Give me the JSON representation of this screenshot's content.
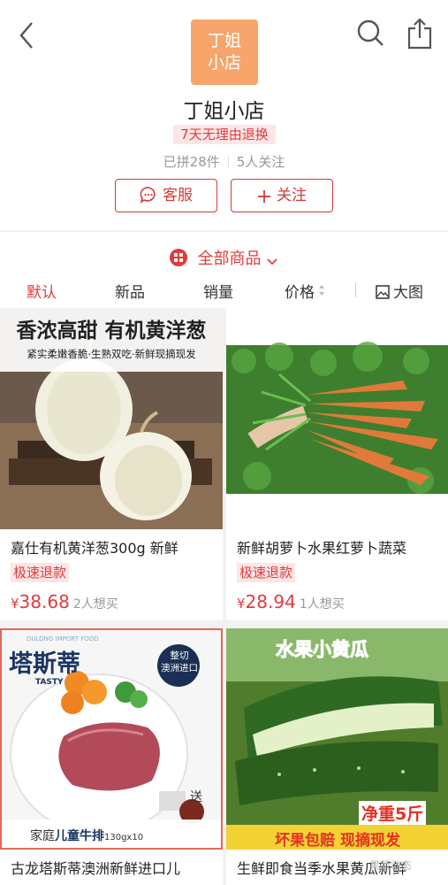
{
  "header": {
    "logo_line1": "丁姐",
    "logo_line2": "小店",
    "store_name": "丁姐小店",
    "return_policy": "7天无理由退换",
    "sold_count": "已拼28件",
    "followers": "5人关注",
    "service_label": "客服",
    "follow_label": "关注"
  },
  "toolbar": {
    "all_products": "全部商品",
    "tabs": [
      "默认",
      "新品",
      "销量",
      "价格",
      "大图"
    ]
  },
  "products": [
    {
      "image_caption_1": "香浓高甜 有机黄洋葱",
      "image_caption_2": "紧实柔嫩香脆·生熟双吃·新鲜现摘现发",
      "title": "嘉仕有机黄洋葱300g 新鲜",
      "badge": "极速退款",
      "currency": "¥",
      "price": "38.68",
      "want": "2人想买"
    },
    {
      "title": "新鲜胡萝卜水果红萝卜蔬菜",
      "badge": "极速退款",
      "currency": "¥",
      "price": "28.94",
      "want": "1人想买"
    },
    {
      "brand_small": "DULONG IMPORT FOOD",
      "brand": "塔斯蒂",
      "brand_en": "TASTY",
      "seal_line1": "整切",
      "seal_line2": "澳洲进口",
      "gift": "送",
      "caption_prefix": "家庭",
      "caption_highlight": "儿童牛排",
      "caption_spec": "130gx10",
      "title": "古龙塔斯蒂澳洲新鲜进口儿"
    },
    {
      "image_caption": "水果小黄瓜",
      "weight": "净重5斤",
      "guarantee": "坏果包赔 现摘现发",
      "title": "生鲜即食当季水果黄瓜新鲜"
    }
  ],
  "watermark": "果蔬动态",
  "colors": {
    "accent": "#e23b3b",
    "logo": "#f7a56b",
    "badge_bg": "#fde6e6"
  }
}
